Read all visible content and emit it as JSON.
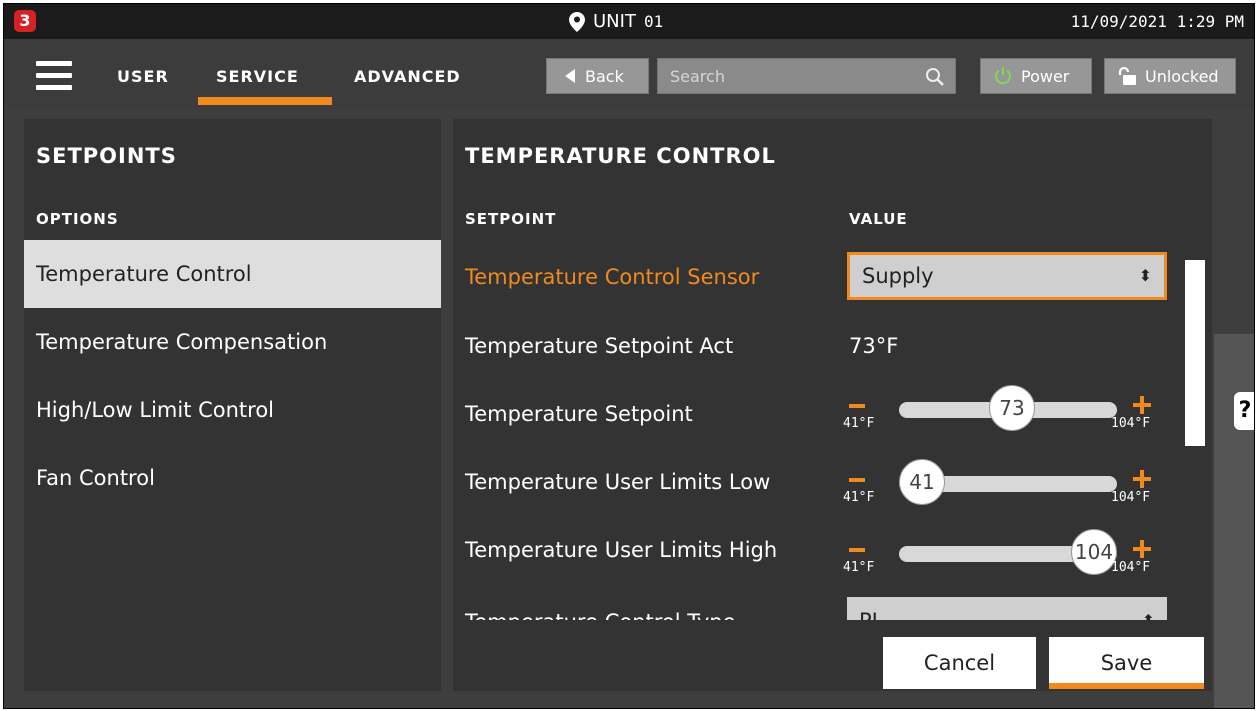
{
  "topbar": {
    "logo_text": "3",
    "unit_label": "UNIT",
    "unit_number": "01",
    "datetime": "11/09/2021 1:29 PM"
  },
  "nav": {
    "tabs": [
      "USER",
      "SERVICE",
      "ADVANCED"
    ],
    "active_tab": "SERVICE",
    "back_label": "Back",
    "search_placeholder": "Search",
    "power_label": "Power",
    "lock_label": "Unlocked"
  },
  "left": {
    "title": "SETPOINTS",
    "header": "OPTIONS",
    "options": [
      "Temperature Control",
      "Temperature Compensation",
      "High/Low Limit Control",
      "Fan Control"
    ],
    "selected": "Temperature Control"
  },
  "right": {
    "title": "TEMPERATURE CONTROL",
    "col_setpoint": "SETPOINT",
    "col_value": "VALUE",
    "rows": [
      {
        "label": "Temperature Control Sensor",
        "type": "select",
        "value": "Supply"
      },
      {
        "label": "Temperature Setpoint Act",
        "type": "text",
        "value": "73°F"
      },
      {
        "label": "Temperature Setpoint",
        "type": "slider",
        "value": "73",
        "min": "41°F",
        "max": "104°F"
      },
      {
        "label": "Temperature User Limits Low",
        "type": "slider",
        "value": "41",
        "min": "41°F",
        "max": "104°F"
      },
      {
        "label": "Temperature User Limits High",
        "type": "slider",
        "value": "104",
        "min": "41°F",
        "max": "104°F"
      },
      {
        "label": "Temperature Control Type",
        "type": "select",
        "value": "PI"
      }
    ]
  },
  "actions": {
    "cancel": "Cancel",
    "save": "Save"
  },
  "help_label": "?",
  "colors": {
    "accent": "#f08a1e",
    "brand_red": "#d62127",
    "power_green": "#7ed957"
  }
}
